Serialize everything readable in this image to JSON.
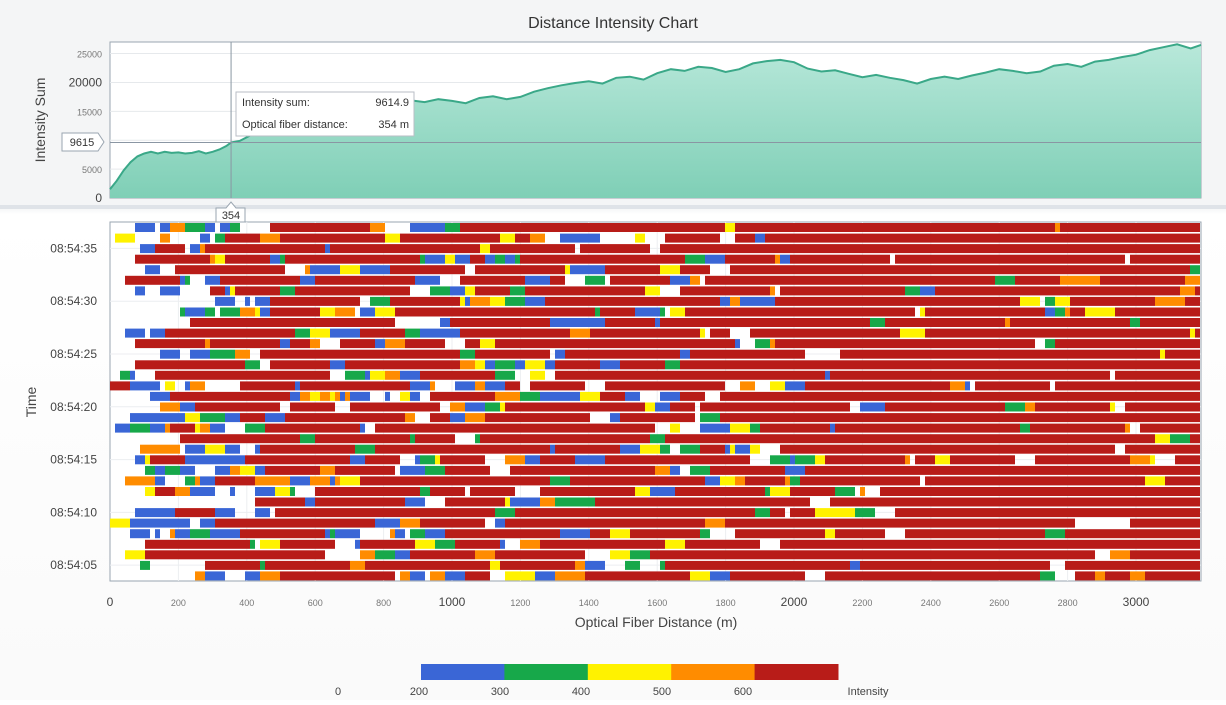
{
  "chart_data": [
    {
      "type": "area",
      "title": "Distance Intensity Chart",
      "ylabel": "Intensity Sum",
      "xlim": [
        0,
        3190
      ],
      "ylim": [
        0,
        27000
      ],
      "y_ticks": [
        {
          "value": 0,
          "label": "0",
          "major": true
        },
        {
          "value": 5000,
          "label": "5000",
          "major": false
        },
        {
          "value": 10000,
          "label": "10000",
          "major": false
        },
        {
          "value": 15000,
          "label": "15000",
          "major": false
        },
        {
          "value": 20000,
          "label": "20000",
          "major": true
        },
        {
          "value": 25000,
          "label": "25000",
          "major": false
        }
      ],
      "series": [
        {
          "x": [
            0,
            20,
            40,
            60,
            80,
            100,
            120,
            140,
            160,
            180,
            200,
            220,
            240,
            260,
            280,
            300,
            320,
            340,
            354,
            380,
            400,
            440,
            480,
            520,
            560,
            600,
            640,
            680,
            720,
            760,
            800,
            840,
            880,
            920,
            960,
            1000,
            1040,
            1080,
            1120,
            1160,
            1200,
            1240,
            1280,
            1320,
            1360,
            1400,
            1440,
            1480,
            1520,
            1560,
            1600,
            1640,
            1680,
            1720,
            1760,
            1800,
            1840,
            1880,
            1920,
            1960,
            2000,
            2040,
            2080,
            2120,
            2160,
            2200,
            2240,
            2280,
            2320,
            2360,
            2400,
            2440,
            2480,
            2520,
            2560,
            2600,
            2640,
            2680,
            2720,
            2760,
            2800,
            2840,
            2880,
            2920,
            2960,
            3000,
            3040,
            3080,
            3120,
            3160,
            3190
          ],
          "values": [
            1500,
            3000,
            4800,
            6200,
            7200,
            7700,
            8000,
            7700,
            8000,
            7800,
            7900,
            7700,
            7800,
            8100,
            7700,
            8000,
            8400,
            9000,
            9615,
            9900,
            10500,
            11800,
            12500,
            13500,
            14000,
            15000,
            16100,
            15800,
            15600,
            16500,
            17000,
            16700,
            16900,
            16600,
            17100,
            16800,
            16400,
            17300,
            17600,
            17100,
            17500,
            18400,
            19000,
            19500,
            19900,
            20200,
            19800,
            20800,
            21000,
            20500,
            21600,
            22300,
            22000,
            22700,
            22500,
            21800,
            22300,
            23300,
            23700,
            23900,
            23500,
            22400,
            21900,
            22100,
            21500,
            20900,
            21300,
            20800,
            20400,
            19800,
            20600,
            21000,
            20600,
            21200,
            21700,
            22300,
            22000,
            21600,
            21900,
            22900,
            23200,
            22700,
            23600,
            23900,
            24400,
            24800,
            25600,
            26100,
            26600,
            25900,
            26500
          ]
        }
      ],
      "tooltip": {
        "x": 354,
        "y": 9614.9,
        "rows": [
          {
            "label": "Intensity sum:",
            "value": "9614.9"
          },
          {
            "label": "Optical fiber distance:",
            "value": "354 m"
          }
        ],
        "x_badge": "354",
        "y_badge": "9615"
      }
    },
    {
      "type": "heatmap",
      "xlabel": "Optical Fiber Distance (m)",
      "ylabel": "Time",
      "xlim": [
        0,
        3190
      ],
      "ylim": [
        "08:54:03.5",
        "08:54:37.5"
      ],
      "x_ticks": [
        {
          "value": 0,
          "label": "0",
          "major": true
        },
        {
          "value": 200,
          "label": "200",
          "major": false
        },
        {
          "value": 400,
          "label": "400",
          "major": false
        },
        {
          "value": 600,
          "label": "600",
          "major": false
        },
        {
          "value": 800,
          "label": "800",
          "major": false
        },
        {
          "value": 1000,
          "label": "1000",
          "major": true
        },
        {
          "value": 1200,
          "label": "1200",
          "major": false
        },
        {
          "value": 1400,
          "label": "1400",
          "major": false
        },
        {
          "value": 1600,
          "label": "1600",
          "major": false
        },
        {
          "value": 1800,
          "label": "1800",
          "major": false
        },
        {
          "value": 2000,
          "label": "2000",
          "major": true
        },
        {
          "value": 2200,
          "label": "2200",
          "major": false
        },
        {
          "value": 2400,
          "label": "2400",
          "major": false
        },
        {
          "value": 2600,
          "label": "2600",
          "major": false
        },
        {
          "value": 2800,
          "label": "2800",
          "major": false
        },
        {
          "value": 3000,
          "label": "3000",
          "major": true
        }
      ],
      "y_ticks": [
        "08:54:05",
        "08:54:10",
        "08:54:15",
        "08:54:20",
        "08:54:25",
        "08:54:30",
        "08:54:35"
      ],
      "time_rows": 34,
      "legend": {
        "title": "Intensity",
        "labels": [
          "0",
          "200",
          "300",
          "400",
          "500",
          "600"
        ],
        "bands": [
          {
            "from": 0,
            "to": 200,
            "color": "#3a66d6"
          },
          {
            "from": 200,
            "to": 300,
            "color": "#17a84a"
          },
          {
            "from": 300,
            "to": 400,
            "color": "#fff200"
          },
          {
            "from": 400,
            "to": 500,
            "color": "#ff8c00"
          },
          {
            "from": 500,
            "to": 600,
            "color": "#b81c18"
          }
        ]
      }
    }
  ]
}
